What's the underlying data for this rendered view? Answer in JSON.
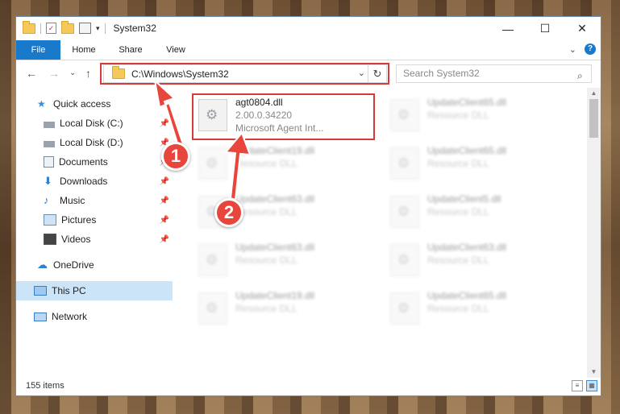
{
  "window": {
    "title": "System32",
    "controls": {
      "minimize": "—",
      "maximize": "☐",
      "close": "✕"
    }
  },
  "ribbon": {
    "tabs": [
      "File",
      "Home",
      "Share",
      "View"
    ],
    "expand": "⌄",
    "help": "?"
  },
  "nav": {
    "back": "←",
    "forward": "→",
    "recent": "⌄",
    "up": "↑",
    "address": "C:\\Windows\\System32",
    "refresh": "↻",
    "search_placeholder": "Search System32"
  },
  "sidebar": {
    "items": [
      {
        "label": "Quick access",
        "icon": "star-icon",
        "pinned": false
      },
      {
        "label": "Local Disk (C:)",
        "icon": "drive-icon",
        "pinned": true
      },
      {
        "label": "Local Disk (D:)",
        "icon": "drive-icon",
        "pinned": true
      },
      {
        "label": "Documents",
        "icon": "documents-icon",
        "pinned": true
      },
      {
        "label": "Downloads",
        "icon": "downloads-icon",
        "pinned": true
      },
      {
        "label": "Music",
        "icon": "music-icon",
        "pinned": true
      },
      {
        "label": "Pictures",
        "icon": "pictures-icon",
        "pinned": true
      },
      {
        "label": "Videos",
        "icon": "videos-icon",
        "pinned": true
      },
      {
        "label": "OneDrive",
        "icon": "onedrive-icon",
        "pinned": false
      },
      {
        "label": "This PC",
        "icon": "computer-icon",
        "pinned": false,
        "selected": true
      },
      {
        "label": "Network",
        "icon": "network-icon",
        "pinned": false
      }
    ]
  },
  "files": {
    "highlighted": {
      "name": "agt0804.dll",
      "version": "2.00.0.34220",
      "description": "Microsoft Agent Int..."
    },
    "others": [
      {
        "name": "UpdateClient65.dll",
        "type": "Resource DLL"
      },
      {
        "name": "UpdateClient19.dll",
        "type": "Resource DLL"
      },
      {
        "name": "UpdateClient65.dll",
        "type": "Resource DLL"
      },
      {
        "name": "UpdateClient63.dll",
        "type": "Resource DLL"
      },
      {
        "name": "UpdateClient5.dll",
        "type": "Resource DLL"
      },
      {
        "name": "UpdateClient63.dll",
        "type": "Resource DLL"
      },
      {
        "name": "UpdateClient63.dll",
        "type": "Resource DLL"
      },
      {
        "name": "UpdateClient19.dll",
        "type": "Resource DLL"
      },
      {
        "name": "UpdateClient65.dll",
        "type": "Resource DLL"
      }
    ]
  },
  "status": {
    "item_count": "155 items"
  },
  "callouts": [
    "1",
    "2"
  ],
  "colors": {
    "accent": "#1979ca",
    "highlight": "#d63b3b",
    "callout": "#e8453c",
    "selected": "#cce4f7"
  }
}
